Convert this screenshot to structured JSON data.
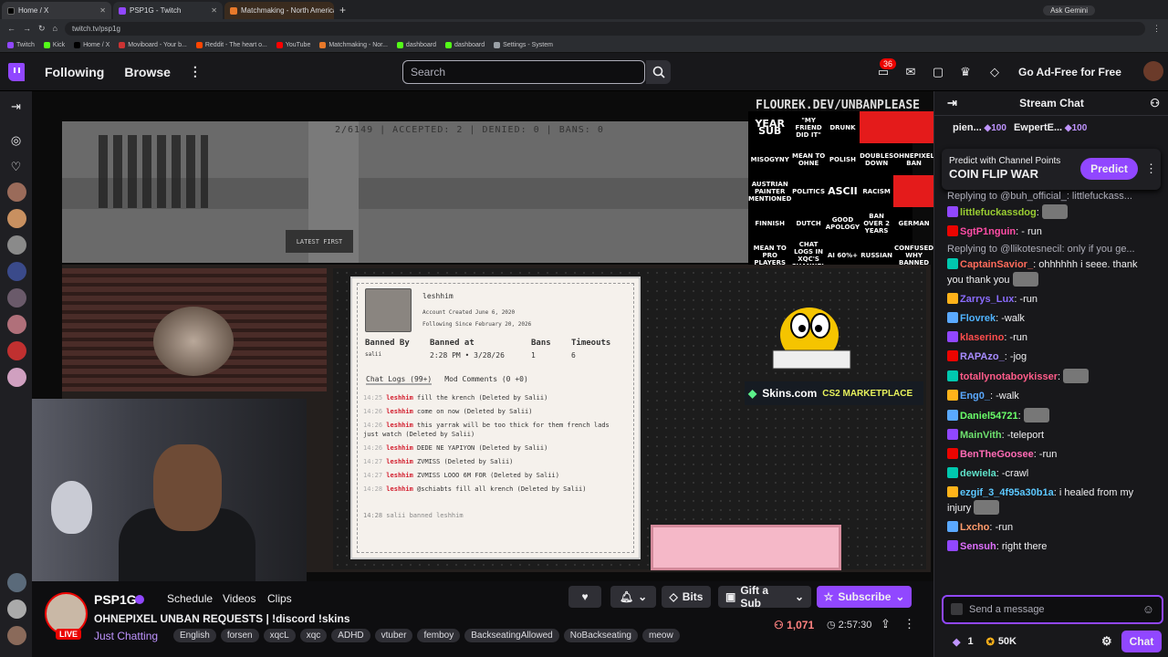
{
  "browser": {
    "tabs": [
      {
        "label": "Home / X",
        "color": "#000000"
      },
      {
        "label": "PSP1G - Twitch",
        "color": "#9147ff"
      },
      {
        "label": "Matchmaking - North America",
        "color": "#e8792a"
      }
    ],
    "url": "twitch.tv/psp1g",
    "ask_gemini": "Ask Gemini",
    "bookmarks": [
      {
        "label": "Twitch",
        "color": "#9147ff"
      },
      {
        "label": "Kick",
        "color": "#53fc18"
      },
      {
        "label": "Home / X",
        "color": "#000000"
      },
      {
        "label": "Moviboard - Your b...",
        "color": "#cc3333"
      },
      {
        "label": "Reddit - The heart o...",
        "color": "#ff4500"
      },
      {
        "label": "YouTube",
        "color": "#ff0000"
      },
      {
        "label": "Matchmaking - Nor...",
        "color": "#e8792a"
      },
      {
        "label": "dashboard",
        "color": "#53fc18"
      },
      {
        "label": "dashboard",
        "color": "#53fc18"
      },
      {
        "label": "Settings - System",
        "color": "#9aa0a6"
      }
    ]
  },
  "nav": {
    "following": "Following",
    "browse": "Browse",
    "search_placeholder": "Search",
    "notifications_count": "36",
    "ad_free": "Go Ad-Free for Free"
  },
  "stream": {
    "overlay_url": "FLOUREK.DEV/UNBANPLEASE",
    "stats": "2/6149 | ACCEPTED: 2 | DENIED: 0 | BANS: 0",
    "latest_first": "LATEST FIRST",
    "bingo": [
      "YEAR SUB",
      "\"MY FRIEND DID IT\"",
      "DRUNK",
      "",
      "",
      "MISOGYNY",
      "MEAN TO OHNE",
      "POLISH",
      "DOUBLES DOWN",
      "OHNEPIXEL BAN",
      "AUSTRIAN PAINTER MENTIONED",
      "POLITICS",
      "ASCII",
      "RACISM",
      "",
      "FINNISH",
      "DUTCH",
      "GOOD APOLOGY",
      "BAN OVER 2 YEARS",
      "GERMAN",
      "MEAN TO PRO PLAYERS",
      "CHAT LOGS IN XQC'S CHANNEL",
      "AI 60%+",
      "RUSSIAN",
      "CONFUSED WHY BANNED"
    ],
    "card": {
      "username": "leshhim",
      "created": "Account Created June 6, 2020",
      "following": "Following Since February 20, 2026",
      "banned_by_label": "Banned By",
      "banned_by_value": "salii",
      "banned_at_label": "Banned at",
      "banned_at_value": "2:28 PM • 3/28/26",
      "bans_label": "Bans",
      "bans_value": "1",
      "timeouts_label": "Timeouts",
      "timeouts_value": "6",
      "tab_logs": "Chat Logs (99+)",
      "tab_mod": "Mod Comments (0 +0)",
      "logs": [
        {
          "time": "14:25",
          "user": "leshhim",
          "text": "fill the krench (Deleted by Salii)"
        },
        {
          "time": "14:26",
          "user": "leshhim",
          "text": "come on now (Deleted by Salii)"
        },
        {
          "time": "14:26",
          "user": "leshhim",
          "text": "this yarrak will be too thick for them french lads just watch (Deleted by Salii)"
        },
        {
          "time": "14:26",
          "user": "leshhim",
          "text": "DEDE NE YAPIYON (Deleted by Salii)"
        },
        {
          "time": "14:27",
          "user": "leshhim",
          "text": "ZVMISS (Deleted by Salii)"
        },
        {
          "time": "14:27",
          "user": "leshhim",
          "text": "ZVMISS LOOO 6M FOR (Deleted by Salii)"
        },
        {
          "time": "14:28",
          "user": "leshhim",
          "text": "@schiabts fill all krench (Deleted by Salii)"
        }
      ],
      "footer": "14:28  salii banned leshhim"
    },
    "sponsor": "Skins.com",
    "sponsor_sub": "CS2 MARKETPLACE"
  },
  "channel": {
    "name": "PSP1G",
    "live": "LIVE",
    "links": [
      "Schedule",
      "Videos",
      "Clips"
    ],
    "title": "OHNEPIXEL UNBAN REQUESTS | !discord !skins",
    "category": "Just Chatting",
    "tags": [
      "English",
      "forsen",
      "xqcL",
      "xqc",
      "ADHD",
      "vtuber",
      "femboy",
      "BackseatingAllowed",
      "NoBackseating",
      "meow"
    ],
    "bits": "Bits",
    "gift": "Gift a Sub",
    "subscribe": "Subscribe",
    "viewers": "1,071",
    "uptime": "2:57:30"
  },
  "chat": {
    "title": "Stream Chat",
    "pinned": [
      {
        "name": "pien...",
        "pts": "100"
      },
      {
        "name": "EwpertE...",
        "pts": "100"
      }
    ],
    "predict_label": "Predict with Channel Points",
    "predict_title": "COIN FLIP WAR",
    "predict_button": "Predict",
    "messages": [
      {
        "reply": "Replying to @buh_official_: littlefuckass...",
        "name": "littlefuckassdog",
        "color": "#9acd32",
        "text": ": ",
        "emote": true
      },
      {
        "name": "SgtP1nguin",
        "color": "#ff4da6",
        "text": ": - run"
      },
      {
        "reply": "Replying to @llikotesnecil: only if you ge...",
        "name": "CaptainSavior_",
        "color": "#ff6b5b",
        "text": ": ohhhhhh i seee. thank you thank you",
        "emote": true
      },
      {
        "name": "Zarrys_Lux",
        "color": "#8a6cff",
        "text": ": -run"
      },
      {
        "name": "Flovrek",
        "color": "#4fb3ff",
        "text": ": -walk"
      },
      {
        "name": "klaserino",
        "color": "#ff4d4d",
        "text": ": -run"
      },
      {
        "name": "RAPAzo_",
        "color": "#a78bff",
        "text": ": -jog"
      },
      {
        "name": "totallynotaboykisser",
        "color": "#ff5c8a",
        "text": ": ",
        "emote": true
      },
      {
        "name": "Eng0_",
        "color": "#5aa9ff",
        "text": ": -walk"
      },
      {
        "name": "Daniel54721",
        "color": "#6aff6a",
        "text": ": ",
        "emote": true
      },
      {
        "name": "MainVith",
        "color": "#6ee06e",
        "text": ": -teleport"
      },
      {
        "name": "BenTheGoosee",
        "color": "#ff6bb5",
        "text": ": -run"
      },
      {
        "name": "dewiela",
        "color": "#5fe0c8",
        "text": ": -crawl"
      },
      {
        "name": "ezgif_3_4f95a30b1a",
        "color": "#5cc8ff",
        "text": ": i healed from my injury",
        "emote": true
      },
      {
        "name": "Lxcho",
        "color": "#ff9b6b",
        "text": ": -run"
      },
      {
        "name": "Sensuh",
        "color": "#e070ff",
        "text": ": right there"
      }
    ],
    "input_placeholder": "Send a message",
    "points_a": "1",
    "points_b": "50K",
    "chat_button": "Chat"
  },
  "colors": {
    "accent": "#9147ff",
    "live": "#eb0400",
    "bg": "#0e0e10"
  }
}
